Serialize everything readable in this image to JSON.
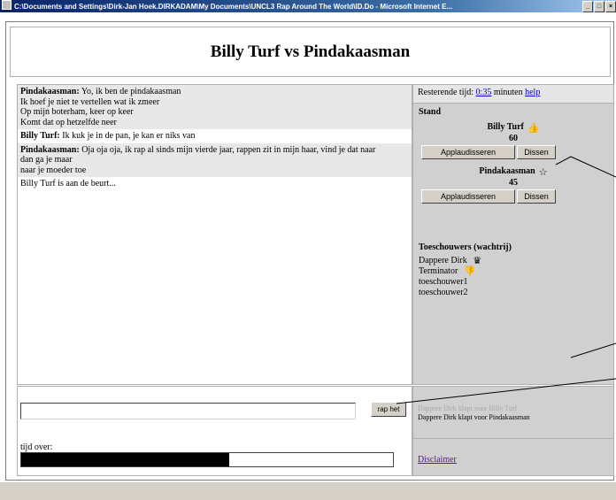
{
  "window": {
    "title": "C:\\Documents and Settings\\Dirk-Jan Hoek.DIRKADAM\\My Documents\\UNCL3 Rap Around The World\\ID.Do - Microsoft Internet E..."
  },
  "page": {
    "title": "Billy Turf vs Pindakaasman"
  },
  "chat": {
    "messages": [
      {
        "speaker": "Pindakaasman:",
        "lines": [
          "Yo, ik ben de pindakaasman",
          "Ik hoef je niet te vertellen wat ik zmeer",
          "Op mijn boterham, keer op keer",
          "Komt dat op hetzelfde neer"
        ],
        "shaded": true
      },
      {
        "speaker": "Billy Turf:",
        "lines": [
          "Ik kuk je in de pan, je kan er niks van"
        ],
        "shaded": false
      },
      {
        "speaker": "Pindakaasman:",
        "lines": [
          "Oja oja oja, ik rap al sinds mijn vierde jaar, rappen zit in mijn haar, vind je dat naar",
          "dan ga je maar",
          "naar je moeder toe"
        ],
        "shaded": true
      },
      {
        "speaker": "",
        "lines": [
          "Billy Turf is aan de beurt..."
        ],
        "shaded": false
      }
    ]
  },
  "timer": {
    "label": "Resterende tijd:",
    "value": "0:35",
    "unit": "minuten",
    "help": "help"
  },
  "stand": {
    "title": "Stand",
    "players": [
      {
        "name": "Billy Turf",
        "score": "60",
        "icon": "thumbs-up-icon",
        "glyph": "👍"
      },
      {
        "name": "Pindakaasman",
        "score": "45",
        "icon": "star-icon",
        "glyph": "☆"
      }
    ],
    "applaud_label": "Applaudisseren",
    "boo_label": "Dissen"
  },
  "spectators": {
    "title": "Toeschouwers (wachtrij)",
    "list": [
      {
        "name": "Dappere Dirk",
        "icon": "crown-icon",
        "glyph": "♛"
      },
      {
        "name": "Terminator",
        "icon": "thumbs-down-icon",
        "glyph": "👎"
      },
      {
        "name": "toeschouwer1"
      },
      {
        "name": "toeschouwer2"
      }
    ]
  },
  "input": {
    "value": "",
    "send_label": "rap het"
  },
  "time_left": {
    "label": "tijd over:",
    "progress": 0.56
  },
  "log": {
    "faint": "Dappere Dirk klapt voor Billy Turf",
    "text": "Dappere Dirk klapt voor Pindakaasman"
  },
  "disclaimer": {
    "label": "Disclaimer"
  }
}
